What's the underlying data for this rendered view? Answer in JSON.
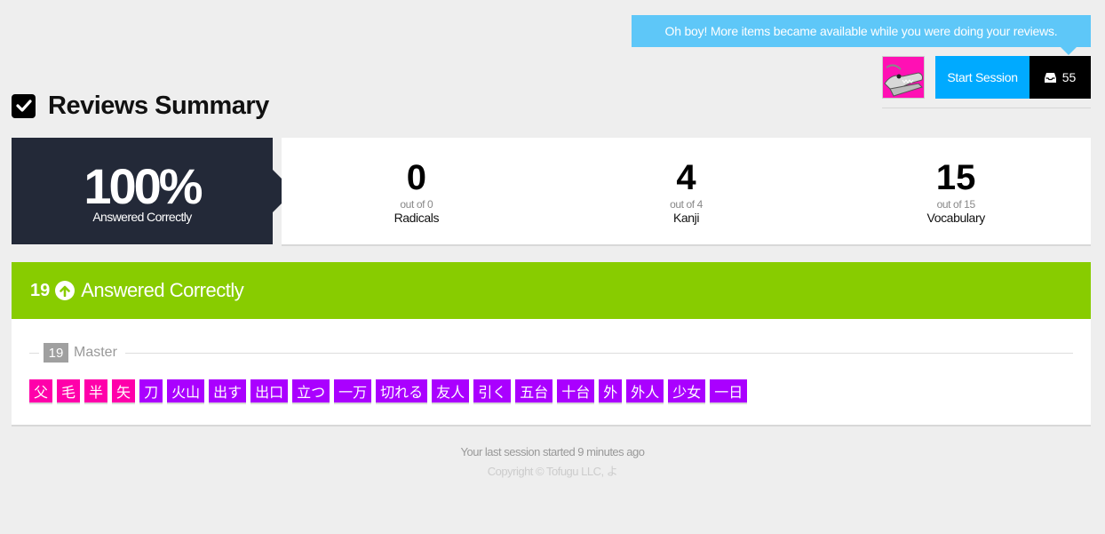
{
  "notice": {
    "text": "Oh boy! More items became available while you were doing your reviews."
  },
  "header": {
    "avatar_icon": "crocodile-avatar-icon",
    "start_session_label": "Start Session",
    "queue_icon": "inbox-icon",
    "queue_count": "55"
  },
  "title": {
    "icon": "checkbox-icon",
    "text": "Reviews Summary"
  },
  "score": {
    "percent": "100%",
    "percent_label": "Answered Correctly",
    "stats": [
      {
        "value": "0",
        "out_of": "out of 0",
        "label": "Radicals"
      },
      {
        "value": "4",
        "out_of": "out of 4",
        "label": "Kanji"
      },
      {
        "value": "15",
        "out_of": "out of 15",
        "label": "Vocabulary"
      }
    ]
  },
  "correct": {
    "count": "19",
    "icon": "arrow-up-circle-icon",
    "title": "Answered Correctly",
    "group": {
      "badge": "19",
      "name": "Master"
    },
    "items": [
      {
        "text": "父",
        "type": "kanji"
      },
      {
        "text": "毛",
        "type": "kanji"
      },
      {
        "text": "半",
        "type": "kanji"
      },
      {
        "text": "矢",
        "type": "kanji"
      },
      {
        "text": "刀",
        "type": "vocab"
      },
      {
        "text": "火山",
        "type": "vocab"
      },
      {
        "text": "出す",
        "type": "vocab"
      },
      {
        "text": "出口",
        "type": "vocab"
      },
      {
        "text": "立つ",
        "type": "vocab"
      },
      {
        "text": "一万",
        "type": "vocab"
      },
      {
        "text": "切れる",
        "type": "vocab"
      },
      {
        "text": "友人",
        "type": "vocab"
      },
      {
        "text": "引く",
        "type": "vocab"
      },
      {
        "text": "五台",
        "type": "vocab"
      },
      {
        "text": "十台",
        "type": "vocab"
      },
      {
        "text": "外",
        "type": "vocab"
      },
      {
        "text": "外人",
        "type": "vocab"
      },
      {
        "text": "少女",
        "type": "vocab"
      },
      {
        "text": "一日",
        "type": "vocab"
      }
    ]
  },
  "footer": {
    "session_text": "Your last session started 9 minutes ago",
    "copyright": "Copyright © Tofugu LLC, よ"
  },
  "colors": {
    "kanji": "#ff00aa",
    "vocab": "#aa00ff",
    "correct": "#88cc00",
    "accent": "#00aaff",
    "dark": "#232938"
  }
}
